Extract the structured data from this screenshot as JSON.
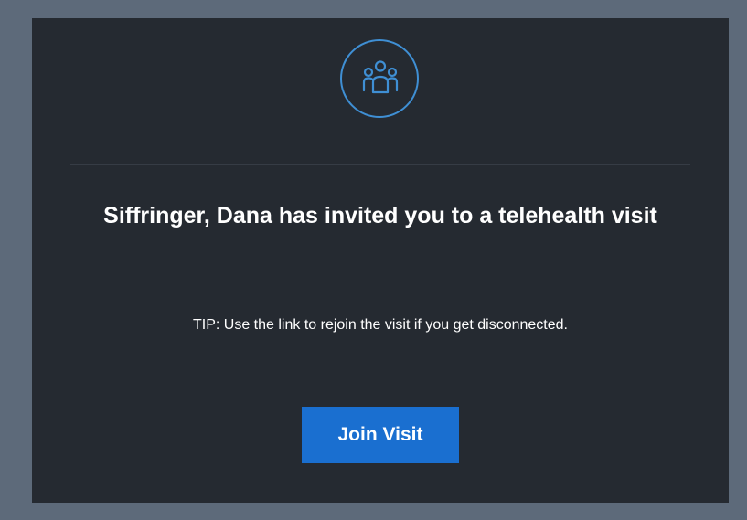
{
  "invite": {
    "icon": "group-icon",
    "heading": "Siffringer, Dana has invited you to a telehealth visit",
    "tip": "TIP: Use the link to rejoin the visit if you get disconnected.",
    "join_label": "Join Visit"
  },
  "colors": {
    "page_background": "#5d6a7a",
    "card_background": "#252a31",
    "accent": "#3f8fd4",
    "button": "#1a6fd0",
    "text": "#ffffff"
  }
}
